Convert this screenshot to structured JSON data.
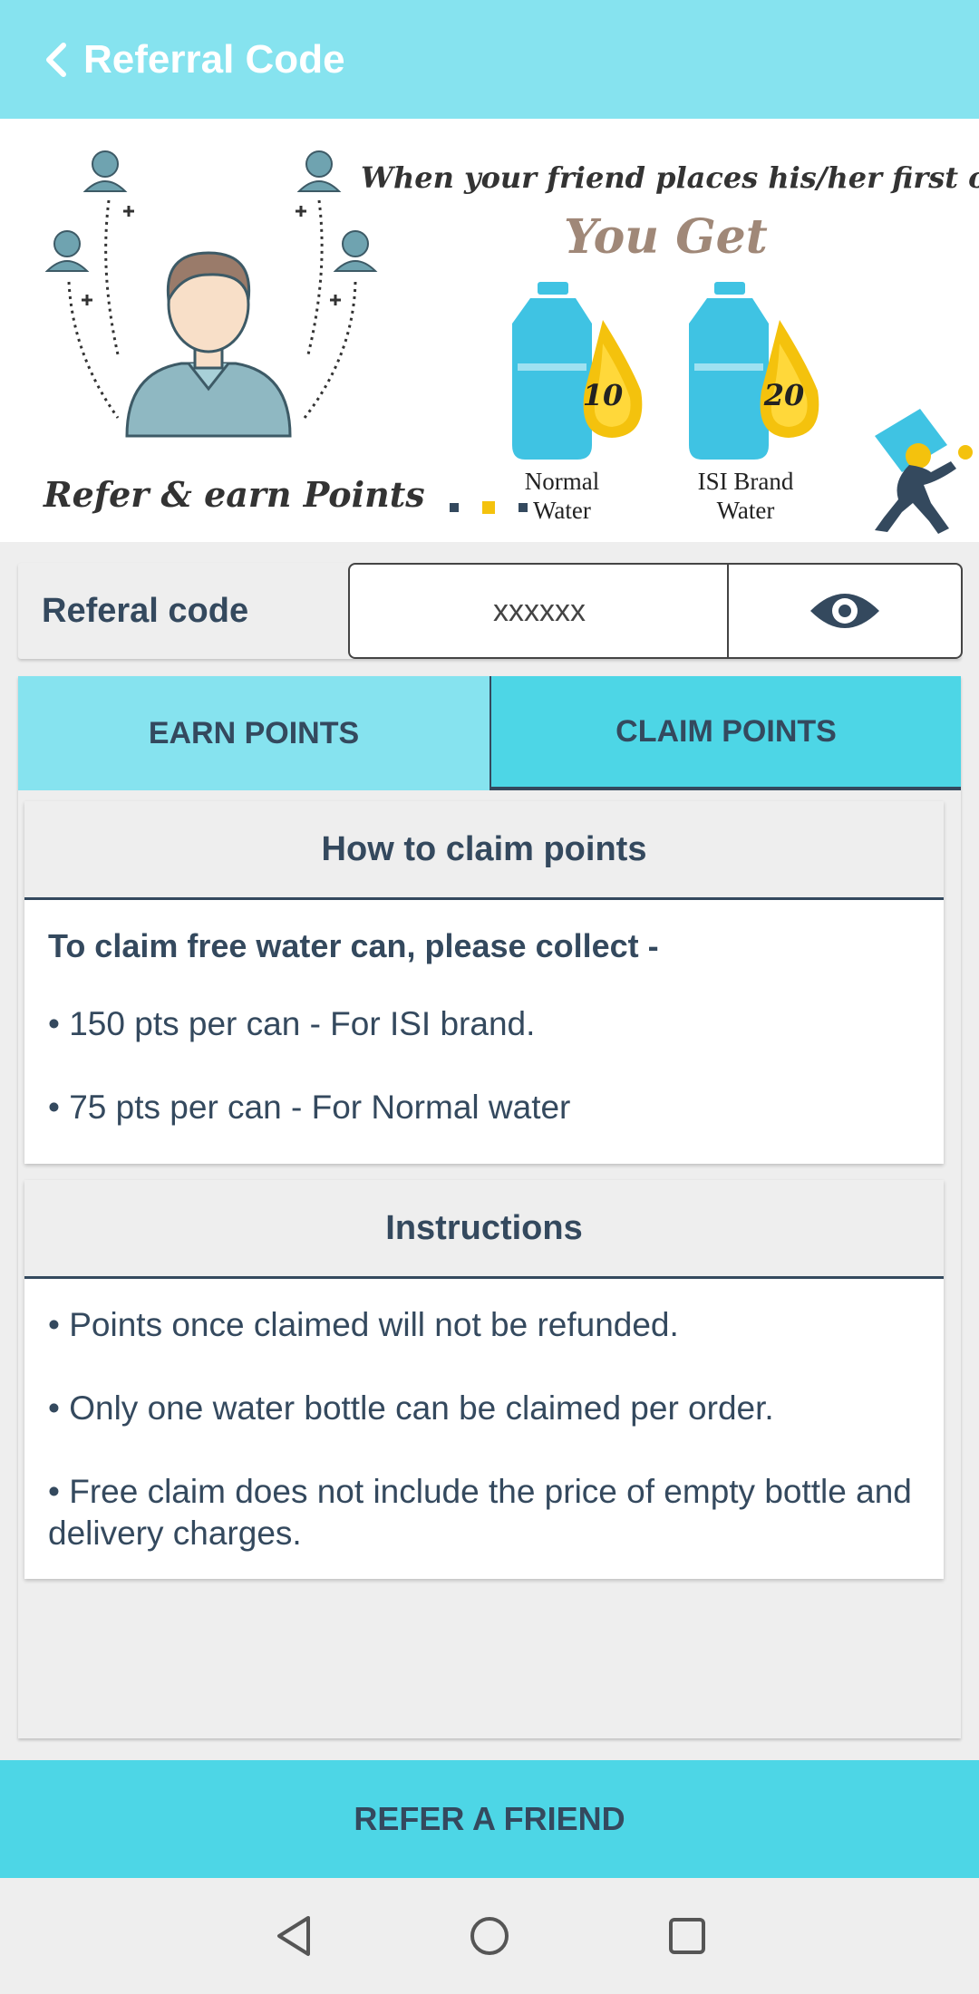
{
  "header": {
    "title": "Referral Code",
    "back_icon": "chevron-left-icon"
  },
  "banner": {
    "headline": "When your friend places his/her first order",
    "you_get": "You Get",
    "refer_text": "Refer & earn Points",
    "cans": [
      {
        "value": "10",
        "label_line1": "Normal",
        "label_line2": "Water"
      },
      {
        "value": "20",
        "label_line1": "ISI Brand",
        "label_line2": "Water"
      }
    ]
  },
  "referral": {
    "label": "Referal code",
    "code": "xxxxxx",
    "reveal_icon": "eye-icon"
  },
  "tabs": [
    {
      "label": "EARN POINTS",
      "active": false
    },
    {
      "label": "CLAIM POINTS",
      "active": true
    }
  ],
  "claim_card": {
    "title": "How to claim points",
    "subtitle": "To claim free water can, please collect -",
    "items": [
      "• 150 pts per can - For ISI brand.",
      "• 75 pts per can - For Normal water"
    ]
  },
  "instructions_card": {
    "title": "Instructions",
    "items": [
      "• Points once claimed will not be refunded.",
      "• Only one water bottle can be claimed per order.",
      " • Free claim does not include the price of empty bottle and delivery charges."
    ]
  },
  "refer_button": {
    "label": "REFER A FRIEND"
  },
  "navbar": {
    "back_icon": "triangle-back-icon",
    "home_icon": "circle-home-icon",
    "recents_icon": "square-recents-icon"
  },
  "colors": {
    "header": "#86e3ef",
    "accent": "#4dd6e6",
    "text": "#34495e",
    "drop": "#f4c20d"
  }
}
